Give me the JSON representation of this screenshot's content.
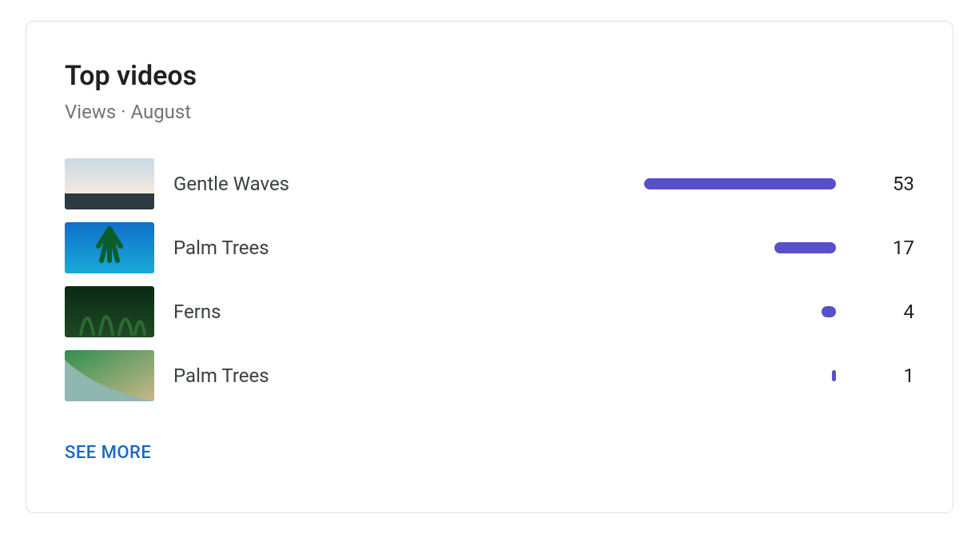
{
  "header": {
    "title": "Top videos",
    "subtitle": "Views · August"
  },
  "videos": [
    {
      "title": "Gentle Waves",
      "views": 53
    },
    {
      "title": "Palm Trees",
      "views": 17
    },
    {
      "title": "Ferns",
      "views": 4
    },
    {
      "title": "Palm Trees",
      "views": 1
    }
  ],
  "actions": {
    "see_more": "SEE MORE"
  },
  "colors": {
    "bar": "#5850c8",
    "link": "#1b66c9"
  },
  "chart_data": {
    "type": "bar",
    "categories": [
      "Gentle Waves",
      "Palm Trees",
      "Ferns",
      "Palm Trees"
    ],
    "values": [
      53,
      17,
      4,
      1
    ],
    "title": "Top videos",
    "xlabel": "",
    "ylabel": "Views",
    "ylim": [
      0,
      53
    ]
  }
}
